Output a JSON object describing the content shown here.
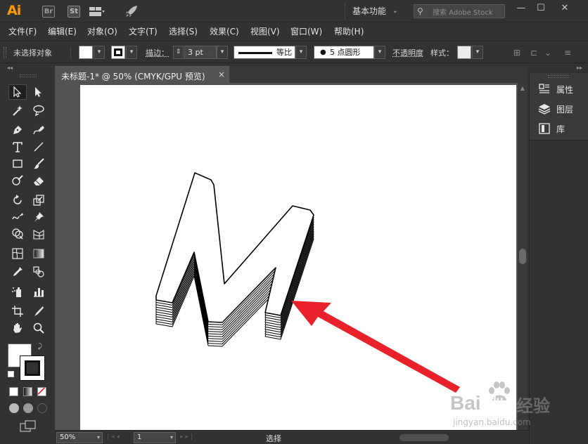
{
  "app": {
    "logo": "Ai",
    "badges": [
      "Br",
      "St"
    ],
    "workspace": "基本功能",
    "search_placeholder": "搜索 Adobe Stock"
  },
  "window_controls": {
    "minimize": "—",
    "maximize": "☐",
    "close": "✕"
  },
  "menu": [
    "文件(F)",
    "编辑(E)",
    "对象(O)",
    "文字(T)",
    "选择(S)",
    "效果(C)",
    "视图(V)",
    "窗口(W)",
    "帮助(H)"
  ],
  "control_bar": {
    "selection_status": "未选择对象",
    "stroke_label": "描边：",
    "stroke_weight": "3 pt",
    "profile_label": "等比",
    "brush_label": "5 点圆形",
    "opacity_label": "不透明度",
    "style_label": "样式："
  },
  "document": {
    "tab_title": "未标题-1* @ 50% (CMYK/GPU 预览)",
    "close": "×"
  },
  "status_bar": {
    "zoom": "50%",
    "page": "1",
    "tool_status": "选择"
  },
  "right_panel": {
    "items": [
      {
        "label": "属性",
        "icon": "properties-icon"
      },
      {
        "label": "图层",
        "icon": "layers-icon"
      },
      {
        "label": "库",
        "icon": "libraries-icon"
      }
    ]
  },
  "artwork": {
    "letter": "M",
    "depth_layers": 10,
    "arrow_color": "#e8212a"
  },
  "watermark": {
    "brand": "Bai",
    "brand2": "du",
    "service": "经验",
    "url": "jingyan.baidu.com"
  },
  "colors": {
    "ui_dark": "#323232",
    "canvas_gray": "#535353",
    "ai_orange": "#ff9a00"
  }
}
